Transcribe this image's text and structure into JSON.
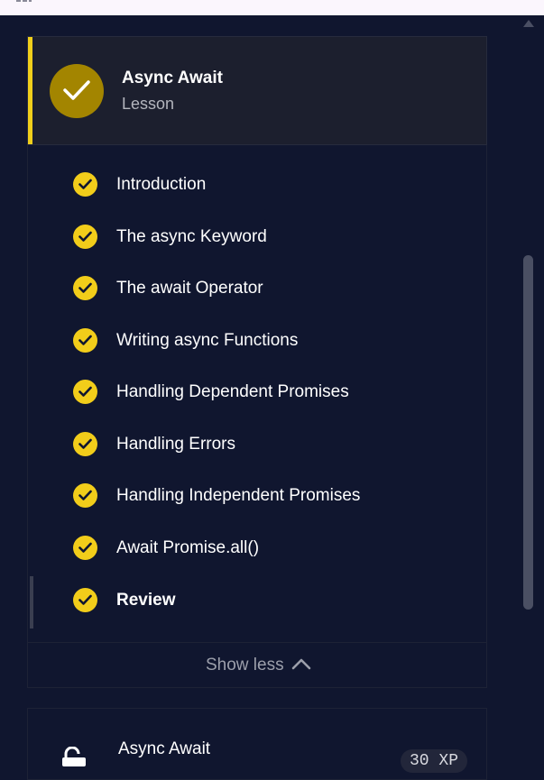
{
  "lesson": {
    "title": "Async Await",
    "type": "Lesson",
    "completed": true,
    "accent_color": "#f0cf1b"
  },
  "items": [
    {
      "label": "Introduction",
      "completed": true
    },
    {
      "label": "The async Keyword",
      "completed": true
    },
    {
      "label": "The await Operator",
      "completed": true
    },
    {
      "label": "Writing async Functions",
      "completed": true
    },
    {
      "label": "Handling Dependent Promises",
      "completed": true
    },
    {
      "label": "Handling Errors",
      "completed": true
    },
    {
      "label": "Handling Independent Promises",
      "completed": true
    },
    {
      "label": "Await Promise.all()",
      "completed": true
    },
    {
      "label": "Review",
      "completed": true,
      "active": true
    }
  ],
  "toggle": {
    "label": "Show less",
    "icon": "chevron-up-icon"
  },
  "next": {
    "title": "Async Await",
    "icon": "unlock-icon",
    "xp": "30 XP"
  }
}
